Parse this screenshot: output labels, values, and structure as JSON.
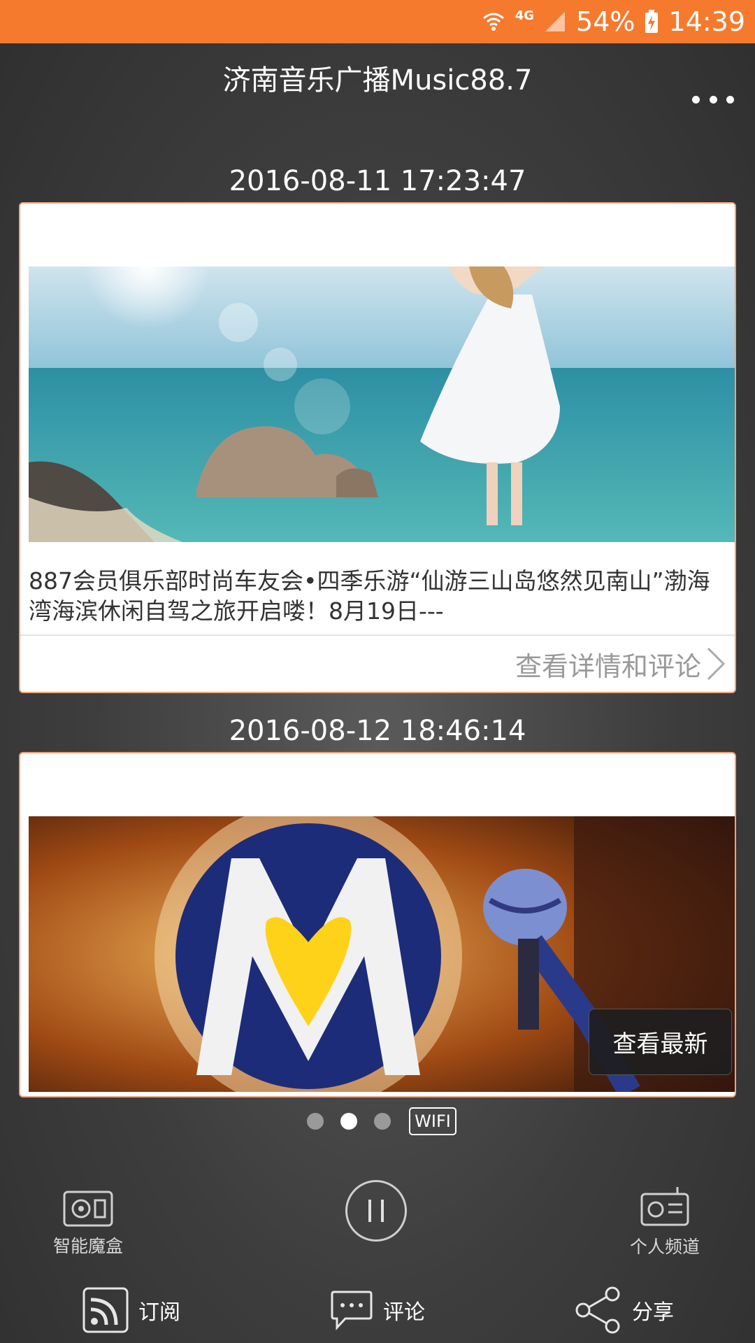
{
  "status_bar": {
    "network": "4G",
    "battery": "54%",
    "time": "14:39"
  },
  "header": {
    "title": "济南音乐广播Music88.7"
  },
  "feed": [
    {
      "timestamp": "2016-08-11 17:23:47",
      "text": "887会员俱乐部时尚车友会•四季乐游“仙游三山岛悠然见南山”渤海湾海滨休闲自驾之旅开启喽！8月19日---",
      "link_label": "查看详情和评论"
    },
    {
      "timestamp": "2016-08-12 18:46:14"
    }
  ],
  "toast": {
    "label": "查看最新"
  },
  "pager": {
    "count": 3,
    "active_index": 1,
    "wifi_label": "WIFI"
  },
  "player": {
    "left_label": "智能魔盒",
    "right_label": "个人频道",
    "state": "pause-icon"
  },
  "bottom_bar": {
    "subscribe_label": "订阅",
    "comment_label": "评论",
    "share_label": "分享"
  },
  "colors": {
    "accent": "#f57a2e",
    "card_border": "#f0a27a"
  }
}
